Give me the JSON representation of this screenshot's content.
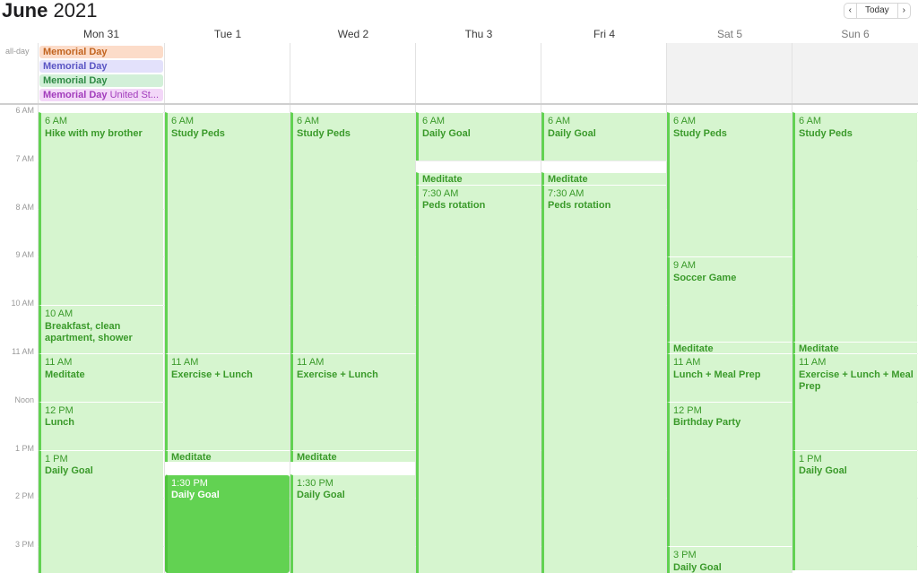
{
  "header": {
    "month": "June",
    "year": "2021",
    "prev_icon": "chevron-left-icon",
    "next_icon": "chevron-right-icon",
    "today_label": "Today"
  },
  "days": [
    "Mon 31",
    "Tue 1",
    "Wed 2",
    "Thu 3",
    "Fri 4",
    "Sat 5",
    "Sun 6"
  ],
  "allday_label": "all-day",
  "allday_events": [
    {
      "name": "Memorial Day",
      "extra": "",
      "color": "#c2641f",
      "bg": "#fcdcc9"
    },
    {
      "name": "Memorial Day",
      "extra": "",
      "color": "#5a55c4",
      "bg": "#e3e1fb"
    },
    {
      "name": "Memorial Day",
      "extra": "",
      "color": "#2f8a45",
      "bg": "#d2f0d8"
    },
    {
      "name": "Memorial Day",
      "extra": "United St...",
      "color": "#a23cbc",
      "bg": "#f3d7f8"
    }
  ],
  "hours": [
    "6 AM",
    "7 AM",
    "8 AM",
    "9 AM",
    "10 AM",
    "11 AM",
    "Noon",
    "1 PM",
    "2 PM",
    "3 PM"
  ],
  "events": [
    {
      "day": 0,
      "start": 6.0,
      "end": 10.0,
      "time": "6 AM",
      "name": "Hike with my brother"
    },
    {
      "day": 0,
      "start": 10.0,
      "end": 11.0,
      "time": "10 AM",
      "name": "Breakfast, clean apartment, shower"
    },
    {
      "day": 0,
      "start": 11.0,
      "end": 12.0,
      "time": "11 AM",
      "name": "Meditate"
    },
    {
      "day": 0,
      "start": 12.0,
      "end": 13.0,
      "time": "12 PM",
      "name": "Lunch"
    },
    {
      "day": 0,
      "start": 13.0,
      "end": 15.6,
      "time": "1 PM",
      "name": "Daily Goal"
    },
    {
      "day": 1,
      "start": 6.0,
      "end": 11.0,
      "time": "6 AM",
      "name": "Study Peds"
    },
    {
      "day": 1,
      "start": 11.0,
      "end": 13.0,
      "time": "11 AM",
      "name": "Exercise + Lunch"
    },
    {
      "day": 1,
      "start": 13.0,
      "end": 13.25,
      "time": "",
      "name": "Meditate"
    },
    {
      "day": 1,
      "start": 13.5,
      "end": 15.6,
      "time": "1:30 PM",
      "name": "Daily Goal",
      "highlight": true
    },
    {
      "day": 2,
      "start": 6.0,
      "end": 11.0,
      "time": "6 AM",
      "name": "Study Peds"
    },
    {
      "day": 2,
      "start": 11.0,
      "end": 13.0,
      "time": "11 AM",
      "name": "Exercise + Lunch"
    },
    {
      "day": 2,
      "start": 13.0,
      "end": 13.25,
      "time": "",
      "name": "Meditate"
    },
    {
      "day": 2,
      "start": 13.5,
      "end": 15.6,
      "time": "1:30 PM",
      "name": "Daily Goal"
    },
    {
      "day": 3,
      "start": 6.0,
      "end": 7.0,
      "time": "6 AM",
      "name": "Daily Goal"
    },
    {
      "day": 3,
      "start": 7.25,
      "end": 7.5,
      "time": "",
      "name": "Meditate"
    },
    {
      "day": 3,
      "start": 7.5,
      "end": 15.6,
      "time": "7:30 AM",
      "name": "Peds rotation"
    },
    {
      "day": 4,
      "start": 6.0,
      "end": 7.0,
      "time": "6 AM",
      "name": "Daily Goal"
    },
    {
      "day": 4,
      "start": 7.25,
      "end": 7.5,
      "time": "",
      "name": "Meditate"
    },
    {
      "day": 4,
      "start": 7.5,
      "end": 15.6,
      "time": "7:30 AM",
      "name": "Peds rotation"
    },
    {
      "day": 5,
      "start": 6.0,
      "end": 9.0,
      "time": "6 AM",
      "name": "Study Peds"
    },
    {
      "day": 5,
      "start": 9.0,
      "end": 10.75,
      "time": "9 AM",
      "name": "Soccer Game"
    },
    {
      "day": 5,
      "start": 10.75,
      "end": 11.0,
      "time": "",
      "name": "Meditate"
    },
    {
      "day": 5,
      "start": 11.0,
      "end": 12.0,
      "time": "11 AM",
      "name": "Lunch + Meal Prep"
    },
    {
      "day": 5,
      "start": 12.0,
      "end": 15.0,
      "time": "12 PM",
      "name": "Birthday Party"
    },
    {
      "day": 5,
      "start": 15.0,
      "end": 15.6,
      "time": "3 PM",
      "name": "Daily Goal"
    },
    {
      "day": 6,
      "start": 6.0,
      "end": 10.75,
      "time": "6 AM",
      "name": "Study Peds"
    },
    {
      "day": 6,
      "start": 10.75,
      "end": 11.0,
      "time": "",
      "name": "Meditate"
    },
    {
      "day": 6,
      "start": 11.0,
      "end": 13.0,
      "time": "11 AM",
      "name": "Exercise + Lunch + Meal Prep"
    },
    {
      "day": 6,
      "start": 13.0,
      "end": 15.5,
      "time": "1 PM",
      "name": "Daily Goal"
    }
  ]
}
